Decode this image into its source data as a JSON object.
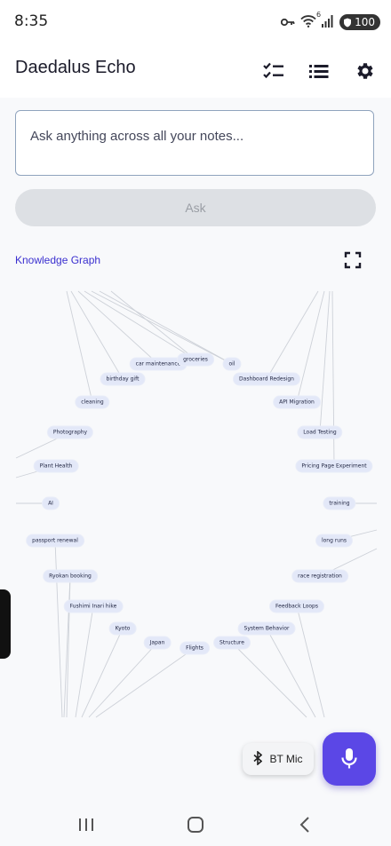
{
  "status": {
    "time": "8:35",
    "battery": "100",
    "wifi_label": "6"
  },
  "app": {
    "title": "Daedalus Echo",
    "icons": [
      "checklist-icon",
      "list-icon",
      "settings-gear-icon"
    ]
  },
  "ask": {
    "placeholder": "Ask anything across all your notes...",
    "button_label": "Ask"
  },
  "knowledge_graph": {
    "title": "Knowledge Graph",
    "fullscreen_icon": "fullscreen-icon",
    "nodes": [
      "car maintenance",
      "groceries",
      "oil",
      "birthday gift",
      "cleaning",
      "Photography",
      "Plant Health",
      "AI",
      "passport renewal",
      "Ryokan booking",
      "Fushimi Inari hike",
      "Kyoto",
      "Japan",
      "Flights",
      "Structure",
      "System Behavior",
      "Feedback Loops",
      "race registration",
      "long runs",
      "training",
      "Pricing Page Experiment",
      "Load Testing",
      "API Migration",
      "Dashboard Redesign"
    ]
  },
  "bt_mic": {
    "label": "BT Mic",
    "icon": "bluetooth-icon"
  },
  "mic": {
    "icon": "microphone-icon"
  },
  "colors": {
    "accent": "#5b47e6",
    "link": "#3a2fcf",
    "node_bg": "#e3e8f8",
    "edge": "#cdd1d8"
  }
}
